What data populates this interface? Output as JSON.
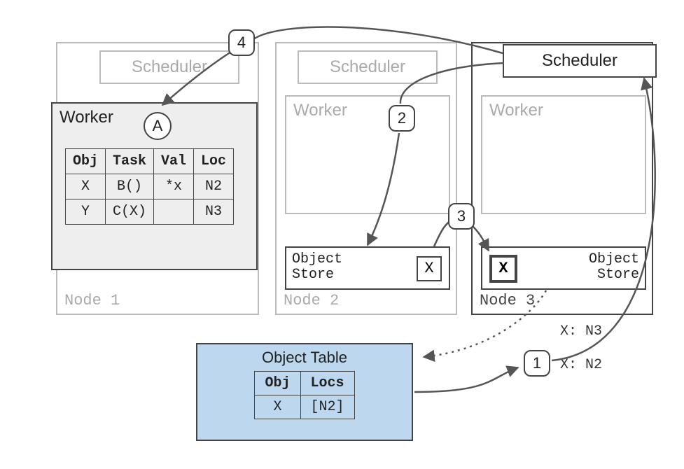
{
  "nodes": {
    "n1": {
      "label": "Node 1",
      "scheduler": "Scheduler",
      "worker": "Worker"
    },
    "n2": {
      "label": "Node 2",
      "scheduler": "Scheduler",
      "worker": "Worker",
      "objstore": "Object\nStore",
      "xval": "X"
    },
    "n3": {
      "label": "Node 3",
      "scheduler": "Scheduler",
      "worker": "Worker",
      "objstore": "Object\nStore",
      "xval": "X"
    }
  },
  "driver_marker": "A",
  "ownership_table": {
    "headers": [
      "Obj",
      "Task",
      "Val",
      "Loc"
    ],
    "rows": [
      [
        "X",
        "B()",
        "*x",
        "N2"
      ],
      [
        "Y",
        "C(X)",
        "",
        "N3"
      ]
    ]
  },
  "object_table": {
    "title": "Object Table",
    "headers": [
      "Obj",
      "Locs"
    ],
    "rows": [
      [
        "X",
        "[N2]"
      ]
    ]
  },
  "steps": {
    "s1": "1",
    "s2": "2",
    "s3": "3",
    "s4": "4"
  },
  "annotations": {
    "a1": "X: N3",
    "a2": "X: N2"
  }
}
